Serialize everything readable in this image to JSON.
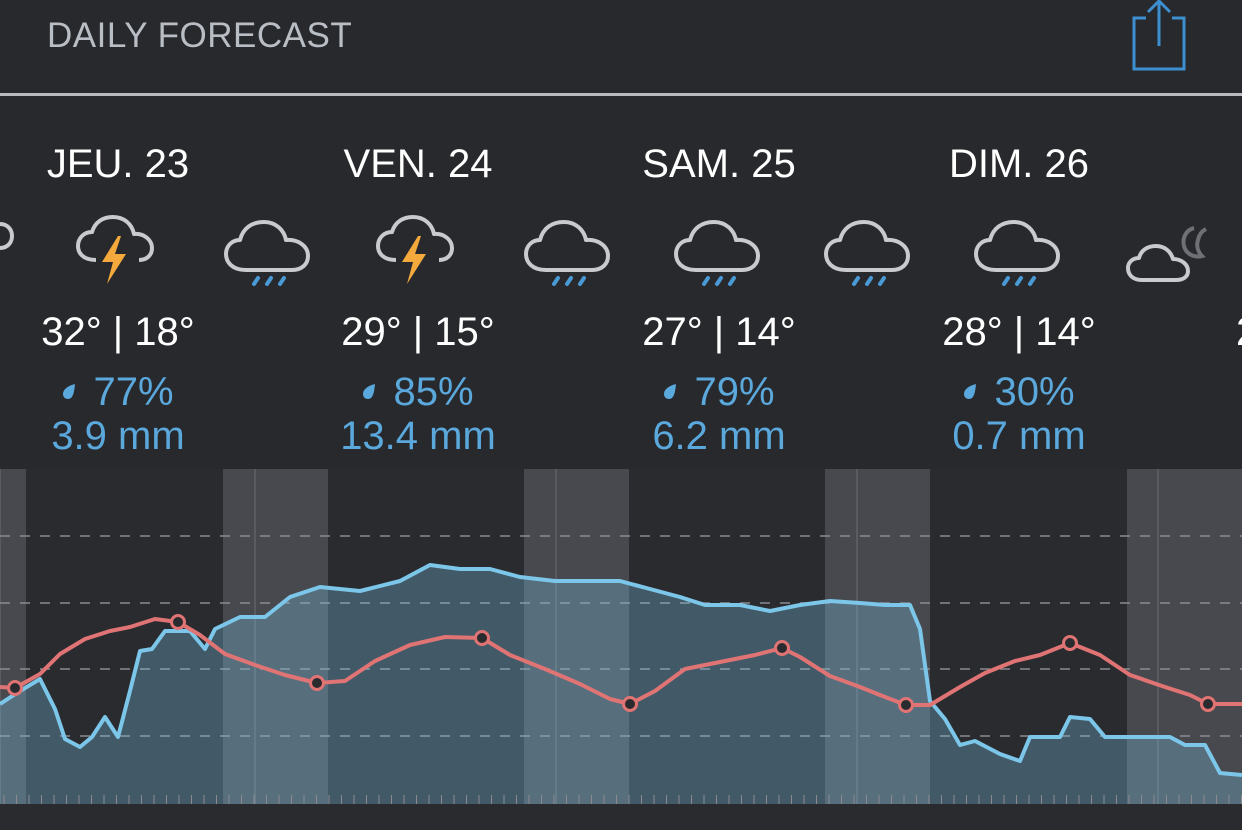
{
  "header": {
    "title": "DAILY FORECAST",
    "share_icon": "share-icon"
  },
  "days": [
    {
      "label": "JEU. 23",
      "icon": "thunderstorm-icon",
      "temps": "32° | 18°",
      "precip_prob": "77%",
      "precip_amount": "3.9 mm"
    },
    {
      "label": "VEN. 24",
      "icon": "thunderstorm-icon",
      "temps": "29° | 15°",
      "precip_prob": "85%",
      "precip_amount": "13.4 mm"
    },
    {
      "label": "SAM. 25",
      "icon": "rain-icon",
      "temps": "27° | 14°",
      "precip_prob": "79%",
      "precip_amount": "6.2 mm"
    },
    {
      "label": "DIM. 26",
      "icon": "rain-icon",
      "temps": "28° | 14°",
      "precip_prob": "30%",
      "precip_amount": "0.7 mm"
    }
  ],
  "night_icons": [
    "rain-icon",
    "rain-icon",
    "rain-icon",
    "partly-cloudy-night-icon"
  ],
  "colors": {
    "background": "#28292d",
    "temperature_line": "#e07474",
    "humidity_line": "#7cc6ea",
    "precip_text": "#5aa8dc",
    "lightning": "#f3a93c"
  }
}
